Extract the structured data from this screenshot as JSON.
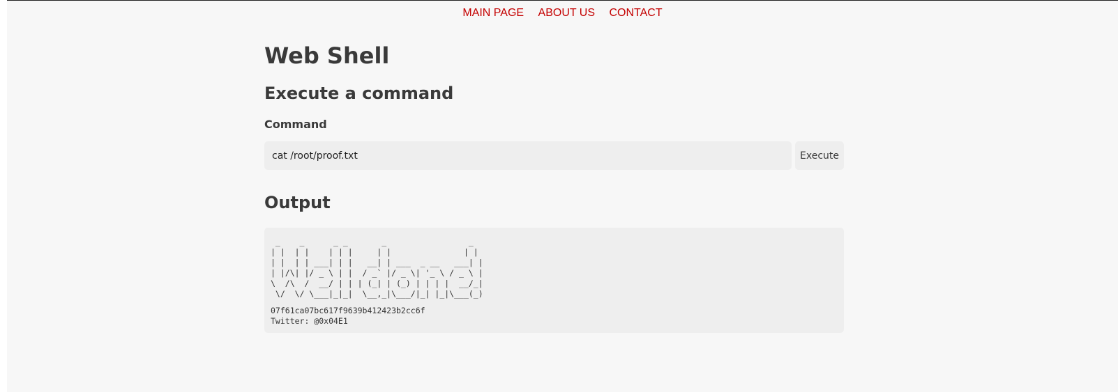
{
  "nav": {
    "items": [
      "MAIN PAGE",
      "ABOUT US",
      "CONTACT"
    ]
  },
  "page_title": "Web Shell",
  "command_section": {
    "heading": "Execute a command",
    "label": "Command",
    "input_value": "cat /root/proof.txt",
    "button_label": "Execute"
  },
  "output_section": {
    "heading": "Output",
    "ascii_art": " _    _      _ _       _                 _ \n| |  | |    | | |     | |               | |\n| |  | | ___| | |   __| | ___  _ __   ___| |\n| |/\\| |/ _ \\ | |  / _` |/ _ \\| '_ \\ / _ \\ |\n\\  /\\  /  __/ | | | (_| | (_) | | | |  __/_|\n \\/  \\/ \\___|_|_|  \\__,_|\\___/|_| |_|\\___(_)",
    "hash": "07f61ca07bc617f9639b412423b2cc6f",
    "twitter": "Twitter: @0x04E1"
  }
}
